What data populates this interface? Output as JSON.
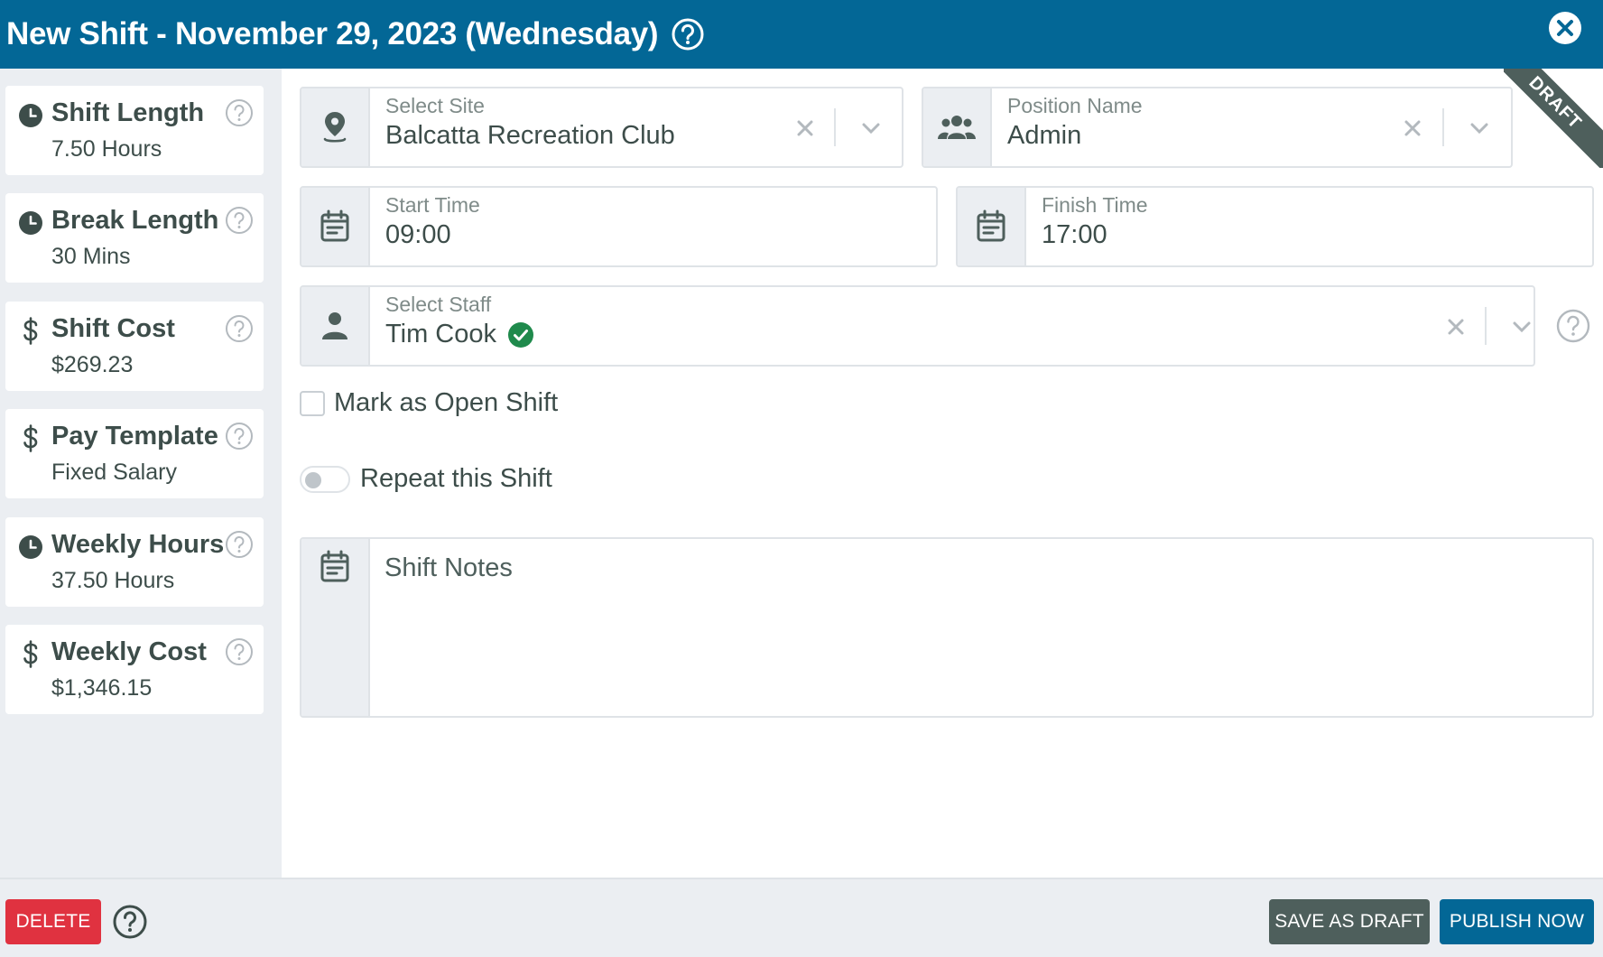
{
  "header": {
    "title": "New Shift - November 29, 2023 (Wednesday)"
  },
  "sidebar": {
    "stats": [
      {
        "label": "Shift Length",
        "value": "7.50 Hours",
        "icon": "clock-icon"
      },
      {
        "label": "Break Length",
        "value": "30 Mins",
        "icon": "clock-icon"
      },
      {
        "label": "Shift Cost",
        "value": "$269.23",
        "icon": "dollar-icon"
      },
      {
        "label": "Pay Template",
        "value": "Fixed Salary",
        "icon": "dollar-icon"
      },
      {
        "label": "Weekly Hours",
        "value": "37.50 Hours",
        "icon": "clock-icon"
      },
      {
        "label": "Weekly Cost",
        "value": "$1,346.15",
        "icon": "dollar-icon"
      }
    ]
  },
  "form": {
    "site": {
      "label": "Select Site",
      "value": "Balcatta Recreation Club"
    },
    "position": {
      "label": "Position Name",
      "value": "Admin"
    },
    "start": {
      "label": "Start Time",
      "value": "09:00"
    },
    "finish": {
      "label": "Finish Time",
      "value": "17:00"
    },
    "staff": {
      "label": "Select Staff",
      "value": "Tim Cook"
    },
    "open_shift_label": "Mark as Open Shift",
    "repeat_label": "Repeat this Shift",
    "notes_placeholder": "Shift Notes",
    "draft_ribbon": "DRAFT"
  },
  "footer": {
    "delete_label": "DELETE",
    "save_draft_label": "SAVE AS DRAFT",
    "publish_label": "PUBLISH NOW"
  },
  "colors": {
    "header_bg": "#036796",
    "delete": "#e03240",
    "draft_button": "#4e5f5c",
    "publish_button": "#036796",
    "verified": "#1f8a4c"
  }
}
